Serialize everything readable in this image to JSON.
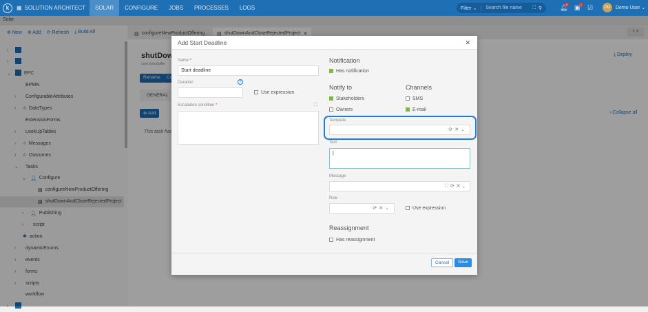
{
  "header": {
    "app_title": "SOLUTION ARCHITECT",
    "nav": [
      "SOLAR",
      "CONFIGURE",
      "JOBS",
      "PROCESSES",
      "LOGS"
    ],
    "active": "SOLAR",
    "filter": "Filter",
    "search_placeholder": "Search file name",
    "notif_count": "8",
    "task_count": "1",
    "user_initials": "DU",
    "user_name": "Demo User"
  },
  "subheader": "Solar",
  "toolbar": {
    "new": "New",
    "add": "Add",
    "refresh": "Refresh",
    "build_all": "Build All"
  },
  "tabs": [
    "configureNewProductOffering",
    "shutDownAndCloseRejectedProject"
  ],
  "tree": [
    {
      "label": "",
      "level": 0,
      "icon": "grid",
      "exp": ">"
    },
    {
      "label": "",
      "level": 0,
      "icon": "grid",
      "exp": ">"
    },
    {
      "label": "EPC",
      "level": 0,
      "icon": "grid",
      "exp": "v"
    },
    {
      "label": "BPMN",
      "level": 1,
      "icon": "folder",
      "exp": ""
    },
    {
      "label": "ConfigurableAttributes",
      "level": 1,
      "icon": "folder",
      "exp": ">"
    },
    {
      "label": "DataTypes",
      "level": 1,
      "icon": "hierarchy",
      "exp": ">"
    },
    {
      "label": "ExtensionForms",
      "level": 1,
      "icon": "folder",
      "exp": ""
    },
    {
      "label": "LookUpTables",
      "level": 1,
      "icon": "folder",
      "exp": ">"
    },
    {
      "label": "Messages",
      "level": 1,
      "icon": "hierarchy",
      "exp": ">"
    },
    {
      "label": "Outcomes",
      "level": 1,
      "icon": "hierarchy",
      "exp": ">"
    },
    {
      "label": "Tasks",
      "level": 1,
      "icon": "folder",
      "exp": "v"
    },
    {
      "label": "Configure",
      "level": 2,
      "icon": "user",
      "exp": "v"
    },
    {
      "label": "configureNewProductOffering",
      "level": 3,
      "icon": "file",
      "exp": ""
    },
    {
      "label": "shutDownAndCloseRejectedProject",
      "level": 3,
      "icon": "file",
      "exp": "",
      "selected": true
    },
    {
      "label": "Publishing",
      "level": 2,
      "icon": "user",
      "exp": ">"
    },
    {
      "label": "script",
      "level": 2,
      "icon": "folder",
      "exp": ">"
    },
    {
      "label": "action",
      "level": 1,
      "icon": "puzzle",
      "exp": ""
    },
    {
      "label": "dynamicEnums",
      "level": 1,
      "icon": "folder",
      "exp": ">"
    },
    {
      "label": "events",
      "level": 1,
      "icon": "events",
      "exp": ">"
    },
    {
      "label": "forms",
      "level": 1,
      "icon": "folder",
      "exp": ">"
    },
    {
      "label": "scripts",
      "level": 1,
      "icon": "folder",
      "exp": ">"
    },
    {
      "label": "workflow",
      "level": 1,
      "icon": "folder",
      "exp": ""
    },
    {
      "label": "",
      "level": 0,
      "icon": "grid",
      "exp": ">"
    }
  ],
  "main": {
    "title": "shutDown",
    "subtitle": "com.kloudville",
    "rename": "Rename",
    "co": "Co",
    "general_tab": "GENERAL",
    "add": "Add",
    "info": "This task has",
    "deploy": "Deploy",
    "collapse_all": "Collapse all"
  },
  "modal": {
    "title": "Add Start Deadline",
    "name_label": "Name",
    "name_value": "Start deadline",
    "duration_label": "Duration",
    "use_expression": "Use expression",
    "escalation_label": "Escalation condition",
    "notification": "Notification",
    "has_notification": "Has notification",
    "notify_to": "Notify to",
    "stakeholders": "Stakeholders",
    "owners": "Owners",
    "channels": "Channels",
    "sms": "SMS",
    "email": "E-mail",
    "template_label": "Template",
    "text_label": "Text",
    "message_label": "Message",
    "role_label": "Role",
    "role_use_expression": "Use expression",
    "reassignment": "Reassignment",
    "has_reassignment": "Has reassignment",
    "cancel": "Cancel",
    "save": "Save"
  },
  "colors": {
    "primary": "#1f6fb5",
    "highlight": "#1a7de0",
    "check": "#7dbb3c"
  }
}
